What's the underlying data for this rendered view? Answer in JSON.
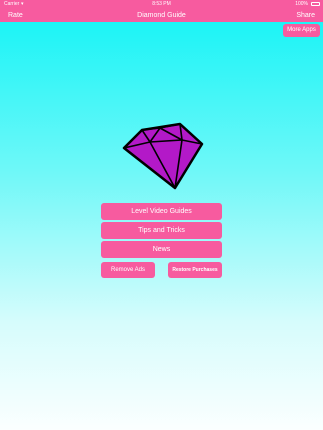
{
  "status_bar": {
    "carrier": "Carrier",
    "wifi_icon": "wifi-icon",
    "time": "8:53 PM",
    "battery_percent": "100%",
    "battery_icon": "battery-icon"
  },
  "nav_bar": {
    "left_button": "Rate",
    "title": "Diamond Guide",
    "right_button": "Share"
  },
  "more_apps_button": "More Apps",
  "hero": {
    "icon": "diamond-icon",
    "fill_color": "#b319c8",
    "outline_color": "#000000"
  },
  "menu": {
    "level_videos": "Level Video Guides",
    "tips": "Tips and Tricks",
    "news": "News",
    "remove_ads": "Remove Ads",
    "restore_purchases": "Restore Purchases"
  },
  "colors": {
    "accent": "#f75b9f",
    "background_top": "#10f3f6",
    "background_bottom": "#fbffff"
  }
}
